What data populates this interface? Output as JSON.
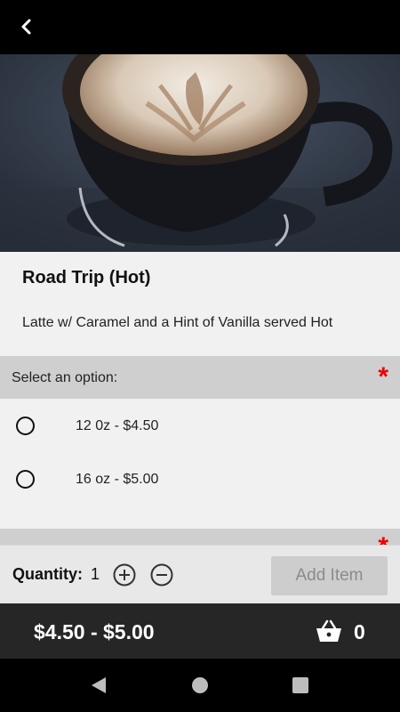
{
  "topbar": {
    "back_icon": "chevron-left-icon"
  },
  "hero": {
    "alt": "latte-photo"
  },
  "item": {
    "title": "Road Trip (Hot)",
    "description": "Latte w/ Caramel and a Hint of Vanilla served Hot"
  },
  "option_section": {
    "title": "Select an option:",
    "required_marker": "*",
    "options": [
      {
        "label": "12 0z - $4.50",
        "selected": false
      },
      {
        "label": "16 oz - $5.00",
        "selected": false
      }
    ]
  },
  "quantity": {
    "label": "Quantity:",
    "value": "1",
    "add_label": "Add Item"
  },
  "footer": {
    "price_range": "$4.50 - $5.00",
    "cart_count": "0"
  },
  "colors": {
    "required": "#ee0000",
    "price_bar": "#262626",
    "disabled_button": "#cdcdcd"
  }
}
